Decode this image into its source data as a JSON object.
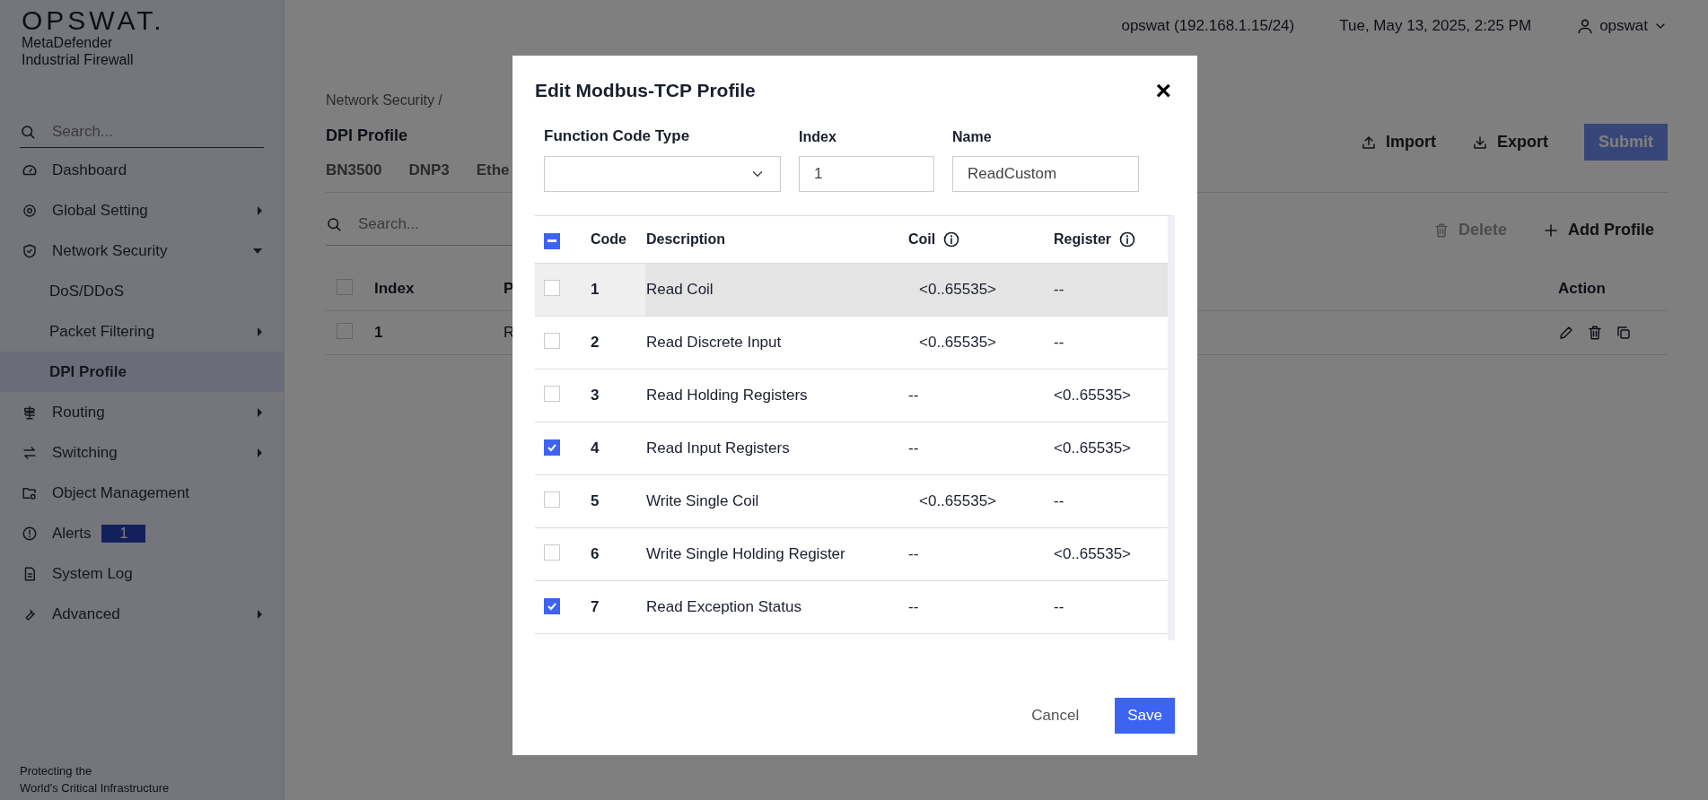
{
  "sidebar": {
    "brand": "OPSWAT.",
    "product": [
      "MetaDefender",
      "Industrial Firewall"
    ],
    "search": {
      "placeholder": "Search..."
    },
    "items": [
      {
        "label": "Dashboard",
        "selected": false
      },
      {
        "label": "Global Setting",
        "selected": false,
        "expanded": false
      },
      {
        "label": "Network Security",
        "selected": false,
        "expanded": true,
        "children": [
          {
            "label": "DoS/DDoS",
            "selected": false
          },
          {
            "label": "Packet Filtering",
            "selected": false,
            "expanded": false
          },
          {
            "label": "DPI Profile",
            "selected": true
          }
        ]
      },
      {
        "label": "Routing",
        "selected": false,
        "expanded": false
      },
      {
        "label": "Switching",
        "selected": false,
        "expanded": false
      },
      {
        "label": "Object Management",
        "selected": false
      },
      {
        "label": "Alerts",
        "selected": false,
        "badge": "1"
      },
      {
        "label": "System Log",
        "selected": false
      },
      {
        "label": "Advanced",
        "selected": false,
        "expanded": false
      }
    ],
    "footer": [
      "Protecting the",
      "World's Critical Infrastructure"
    ]
  },
  "header": {
    "host": "opswat (192.168.1.15/24)",
    "datetime": "Tue, May 13, 2025, 2:25 PM",
    "user": "opswat"
  },
  "page": {
    "breadcrumb": "Network Security /",
    "title": "DPI Profile",
    "tabs": [
      "BN3500",
      "DNP3",
      "Ethe"
    ],
    "actions": [
      {
        "label": "Import",
        "kind": "import",
        "disabled": false
      },
      {
        "label": "Export",
        "kind": "export",
        "disabled": false
      },
      {
        "label": "Submit",
        "kind": "submit",
        "disabled": true
      }
    ],
    "search": {
      "placeholder": "Search..."
    },
    "toolbar": [
      {
        "label": "Delete",
        "kind": "delete",
        "disabled": true
      },
      {
        "label": "Add Profile",
        "kind": "add",
        "disabled": false
      }
    ],
    "table": {
      "select_all": {
        "checked": false
      },
      "columns": [
        "Index",
        "P",
        "Action"
      ],
      "rows": [
        {
          "checked": false,
          "cells": [
            "1",
            "R"
          ]
        }
      ]
    }
  },
  "dialog": {
    "title": "Edit Modbus-TCP Profile",
    "close": "×",
    "fields": [
      {
        "label": "Function Code Type",
        "kind": "select"
      },
      {
        "label": "Index",
        "kind": "text",
        "value": "1"
      },
      {
        "label": "Name",
        "kind": "text",
        "value": "ReadCustom"
      }
    ],
    "table": {
      "select_all": {
        "indeterminate": true
      },
      "columns": [
        {
          "label": "Code",
          "info": false
        },
        {
          "label": "Description",
          "info": false
        },
        {
          "label": "Coil",
          "info": true
        },
        {
          "label": "Register",
          "info": true
        }
      ],
      "rows": [
        {
          "code": "1",
          "description": "Read Coil",
          "coil": "<0..65535>",
          "register": "--",
          "checked": false,
          "selected": true
        },
        {
          "code": "2",
          "description": "Read Discrete Input",
          "coil": "<0..65535>",
          "register": "--",
          "checked": false,
          "selected": false
        },
        {
          "code": "3",
          "description": "Read Holding Registers",
          "coil": "--",
          "register": "<0..65535>",
          "checked": false,
          "selected": false
        },
        {
          "code": "4",
          "description": "Read Input Registers",
          "coil": "--",
          "register": "<0..65535>",
          "checked": true,
          "selected": false
        },
        {
          "code": "5",
          "description": "Write Single Coil",
          "coil": "<0..65535>",
          "register": "--",
          "checked": false,
          "selected": false
        },
        {
          "code": "6",
          "description": "Write Single Holding Register",
          "coil": "--",
          "register": "<0..65535>",
          "checked": false,
          "selected": false
        },
        {
          "code": "7",
          "description": "Read Exception Status",
          "coil": "--",
          "register": "--",
          "checked": true,
          "selected": false
        }
      ]
    },
    "buttons": [
      {
        "label": "Cancel",
        "kind": "secondary"
      },
      {
        "label": "Save",
        "kind": "primary"
      }
    ]
  }
}
